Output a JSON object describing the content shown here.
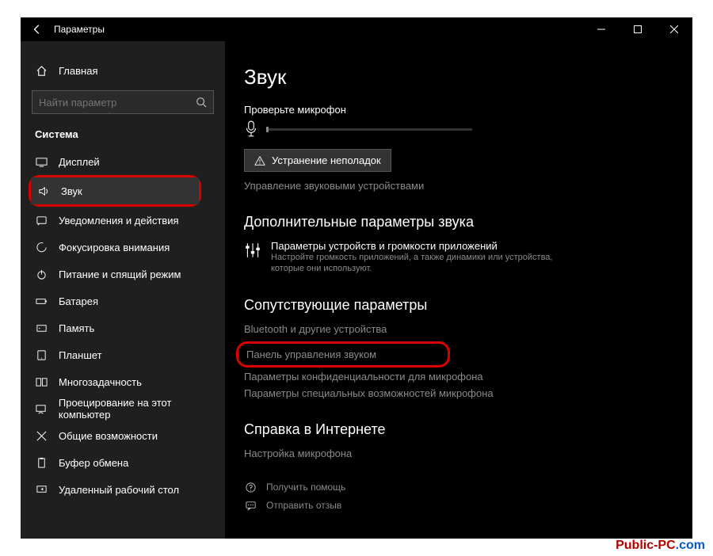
{
  "window": {
    "title": "Параметры"
  },
  "sidebar": {
    "home": "Главная",
    "search_placeholder": "Найти параметр",
    "section": "Система",
    "items": [
      {
        "label": "Дисплей",
        "selected": false
      },
      {
        "label": "Звук",
        "selected": true
      },
      {
        "label": "Уведомления и действия",
        "selected": false
      },
      {
        "label": "Фокусировка внимания",
        "selected": false
      },
      {
        "label": "Питание и спящий режим",
        "selected": false
      },
      {
        "label": "Батарея",
        "selected": false
      },
      {
        "label": "Память",
        "selected": false
      },
      {
        "label": "Планшет",
        "selected": false
      },
      {
        "label": "Многозадачность",
        "selected": false
      },
      {
        "label": "Проецирование на этот компьютер",
        "selected": false
      },
      {
        "label": "Общие возможности",
        "selected": false
      },
      {
        "label": "Буфер обмена",
        "selected": false
      },
      {
        "label": "Удаленный рабочий стол",
        "selected": false
      }
    ]
  },
  "main": {
    "heading": "Звук",
    "mic_test_label": "Проверьте микрофон",
    "troubleshoot_label": "Устранение неполадок",
    "manage_devices_link": "Управление звуковыми устройствами",
    "advanced_heading": "Дополнительные параметры звука",
    "app_volume": {
      "title": "Параметры устройств и громкости приложений",
      "desc": "Настройте громкость приложений, а также динамики или устройства, которые они используют."
    },
    "related_heading": "Сопутствующие параметры",
    "related_links": [
      "Bluetooth и другие устройства",
      "Панель управления звуком",
      "Параметры конфиденциальности для микрофона",
      "Параметры специальных возможностей микрофона"
    ],
    "web_help_heading": "Справка в Интернете",
    "web_help_link": "Настройка микрофона",
    "footer": {
      "get_help": "Получить помощь",
      "feedback": "Отправить отзыв"
    }
  },
  "watermark": {
    "a": "Public-PC",
    "b": ".com"
  }
}
